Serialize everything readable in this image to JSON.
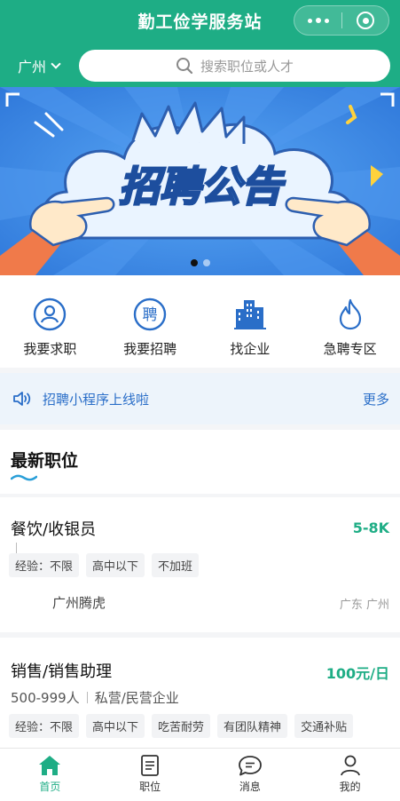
{
  "header": {
    "title": "勤工俭学服务站",
    "city": "广州",
    "search_placeholder": "搜索职位或人才"
  },
  "banner": {
    "headline": "招聘公告",
    "slide_count": 2,
    "active_slide": 1
  },
  "quick_entries": [
    {
      "label": "我要求职",
      "icon": "job-seeker-icon"
    },
    {
      "label": "我要招聘",
      "icon": "recruit-icon",
      "glyph": "聘"
    },
    {
      "label": "找企业",
      "icon": "building-icon"
    },
    {
      "label": "急聘专区",
      "icon": "flame-icon"
    }
  ],
  "notice": {
    "text": "招聘小程序上线啦",
    "more": "更多"
  },
  "latest": {
    "heading": "最新职位"
  },
  "jobs": [
    {
      "title": "餐饮/收银员",
      "salary": "5-8K",
      "tags": [
        "经验：不限",
        "高中以下",
        "不加班"
      ],
      "company": "广州腾虎",
      "location": "广东  广州"
    },
    {
      "title": "销售/销售助理",
      "salary": "100元/日",
      "size": "500-999人",
      "type": "私营/民营企业",
      "tags": [
        "经验：不限",
        "高中以下",
        "吃苦耐劳",
        "有团队精神",
        "交通补贴"
      ]
    }
  ],
  "tabbar": [
    {
      "label": "首页",
      "icon": "home-icon",
      "active": true
    },
    {
      "label": "职位",
      "icon": "document-icon",
      "active": false
    },
    {
      "label": "消息",
      "icon": "chat-icon",
      "active": false
    },
    {
      "label": "我的",
      "icon": "profile-icon",
      "active": false
    }
  ],
  "colors": {
    "brand": "#1ead85",
    "link": "#2a6ec8",
    "icon_blue": "#2a6ec8"
  }
}
